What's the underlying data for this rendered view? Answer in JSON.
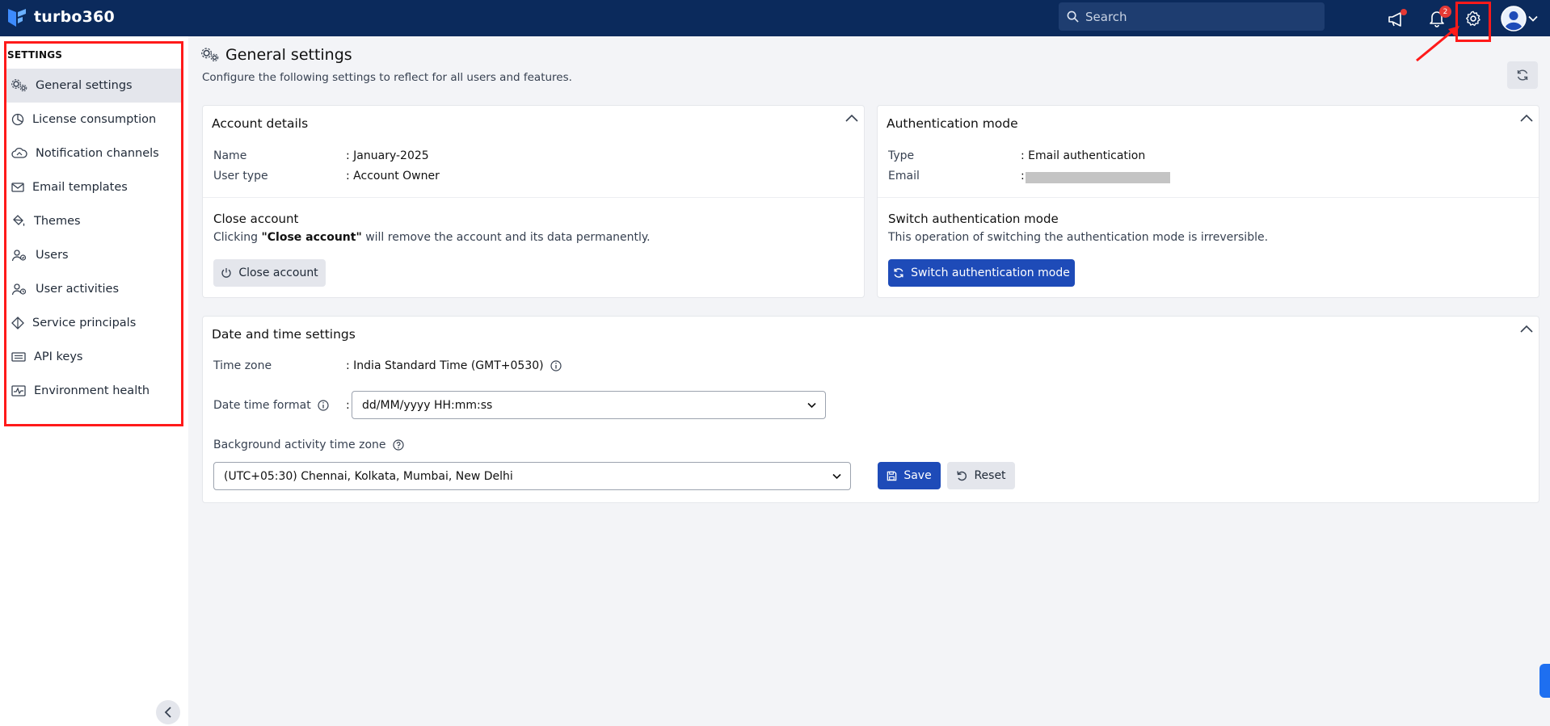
{
  "app": {
    "name": "turbo360"
  },
  "header": {
    "search_placeholder": "Search",
    "notifications_count": "2"
  },
  "sidebar": {
    "title": "SETTINGS",
    "items": [
      {
        "label": "General settings",
        "icon": "general-settings-icon",
        "active": true
      },
      {
        "label": "License consumption",
        "icon": "pie-chart-icon"
      },
      {
        "label": "Notification channels",
        "icon": "cloud-icon"
      },
      {
        "label": "Email templates",
        "icon": "envelope-icon"
      },
      {
        "label": "Themes",
        "icon": "paint-bucket-icon"
      },
      {
        "label": "Users",
        "icon": "users-icon"
      },
      {
        "label": "User activities",
        "icon": "user-activity-icon"
      },
      {
        "label": "Service principals",
        "icon": "service-principal-icon"
      },
      {
        "label": "API keys",
        "icon": "api-key-icon"
      },
      {
        "label": "Environment health",
        "icon": "health-monitor-icon"
      }
    ]
  },
  "page": {
    "title": "General settings",
    "subtitle": "Configure the following settings to reflect for all users and features."
  },
  "account": {
    "title": "Account details",
    "name_label": "Name",
    "name_value": ": January-2025",
    "usertype_label": "User type",
    "usertype_value": ": Account Owner",
    "close_title": "Close account",
    "close_text_prefix": "Clicking ",
    "close_text_bold": "\"Close account\"",
    "close_text_suffix": " will remove the account and its data permanently.",
    "close_button": "Close account"
  },
  "auth": {
    "title": "Authentication mode",
    "type_label": "Type",
    "type_value": ":  Email authentication",
    "email_label": "Email",
    "email_value": ":",
    "switch_title": "Switch authentication mode",
    "switch_text": "This operation of switching the authentication mode is irreversible.",
    "switch_button": "Switch authentication mode"
  },
  "datetime": {
    "title": "Date and time settings",
    "tz_label": "Time zone",
    "tz_value": ": India Standard Time (GMT+0530)",
    "format_label": "Date time format",
    "format_colon": ":",
    "format_value": "dd/MM/yyyy HH:mm:ss",
    "bg_label": "Background activity time zone",
    "bg_value": "(UTC+05:30) Chennai, Kolkata, Mumbai, New Delhi",
    "save_button": "Save",
    "reset_button": "Reset"
  },
  "colors": {
    "topbar": "#0b2a5c",
    "primary": "#1e4bb8",
    "highlight": "#ff1a1a"
  }
}
